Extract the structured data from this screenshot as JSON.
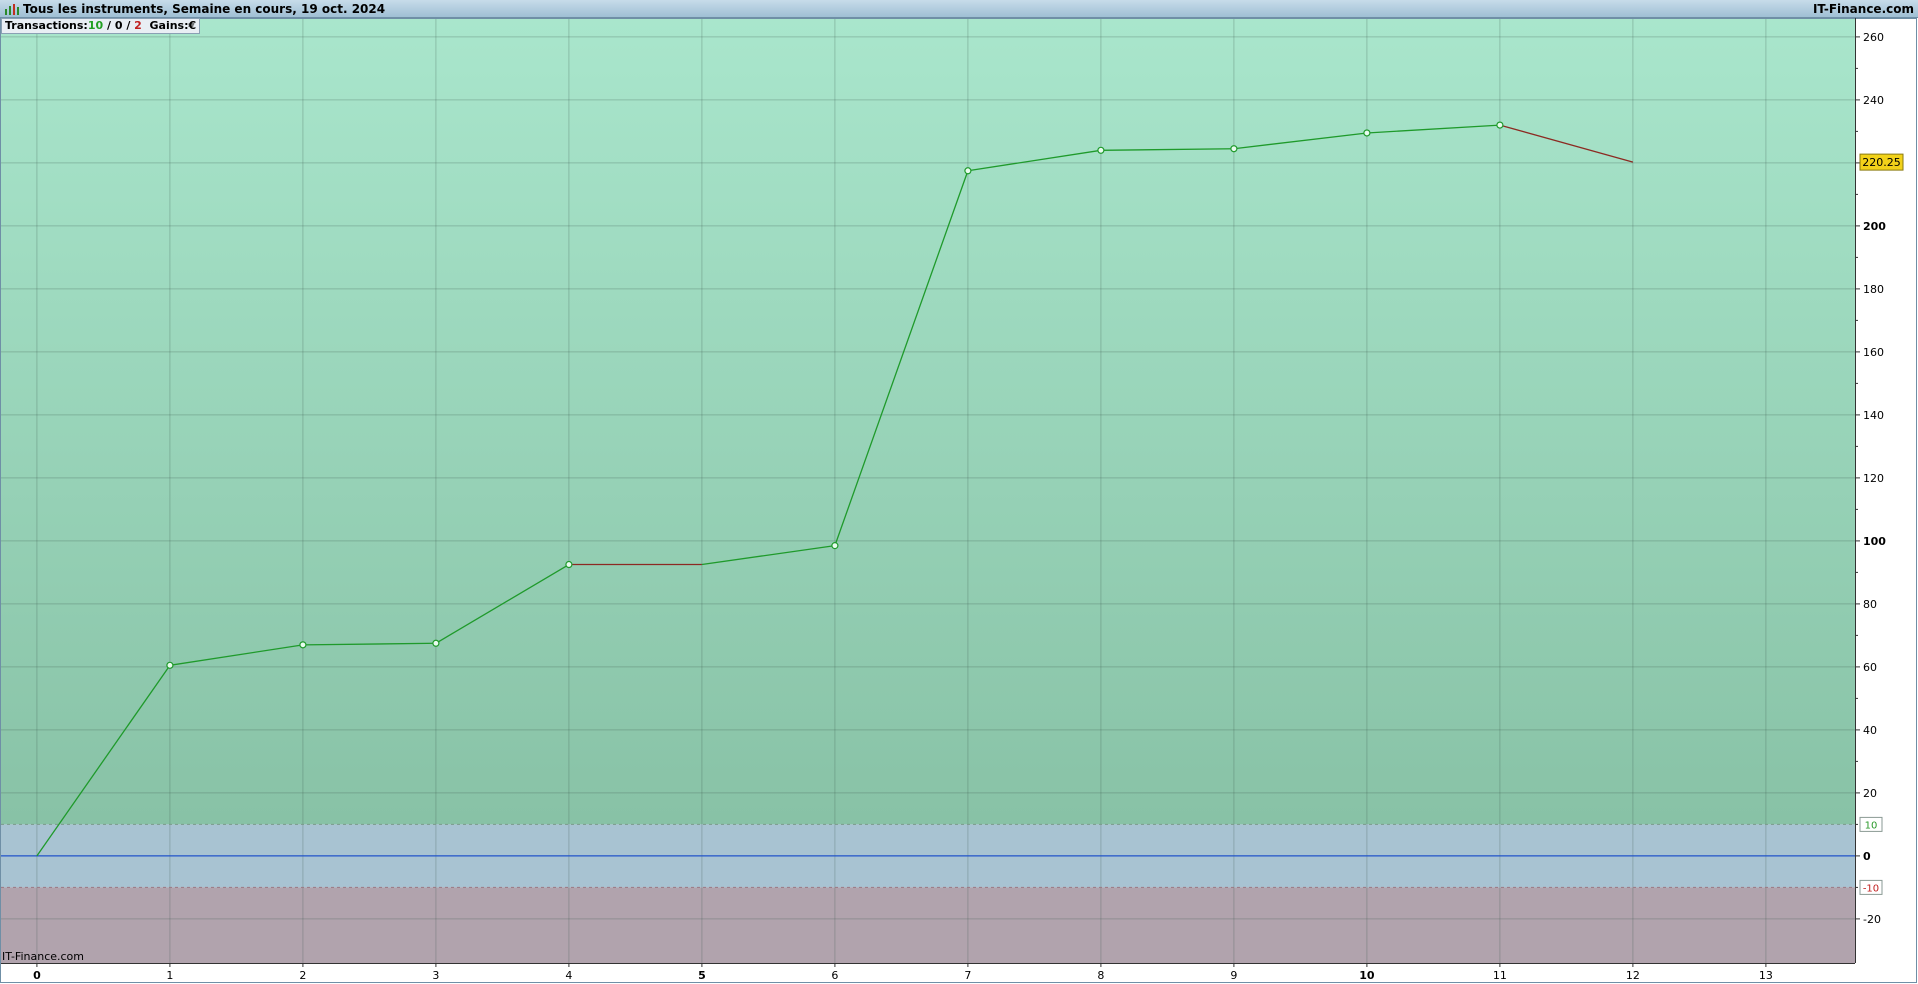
{
  "header": {
    "title": "Tous les instruments, Semaine en cours, 19 oct. 2024",
    "brand": "IT-Finance.com"
  },
  "info_box": {
    "label": "Transactions:",
    "wins": "10",
    "sep1": " / ",
    "neutral": "0",
    "sep2": " / ",
    "losses": "2",
    "gains_label": "Gains:",
    "currency": "€"
  },
  "footer": {
    "brand": "IT-Finance.com"
  },
  "colors": {
    "plot_top": "#a9e6cc",
    "plot_bottom": "#88c2a6",
    "neutral_band": "#a8c3d2",
    "negative_band": "#b1a3ad",
    "line_up": "#1f9a2b",
    "line_down": "#8c2a22",
    "zero_line": "#2255cc",
    "current_badge": "#f2d21a"
  },
  "chart_data": {
    "type": "line",
    "x": [
      0,
      1,
      2,
      3,
      4,
      5,
      6,
      7,
      8,
      9,
      10,
      11,
      12
    ],
    "values": [
      0,
      60.5,
      67,
      67.5,
      92.5,
      92.5,
      98.5,
      217.5,
      224,
      224.5,
      229.5,
      232,
      220.25
    ],
    "segment_direction": [
      "up",
      "up",
      "up",
      "up",
      "down",
      "up",
      "up",
      "up",
      "up",
      "up",
      "up",
      "down"
    ],
    "markers": [
      1,
      2,
      3,
      4,
      6,
      7,
      8,
      9,
      10,
      11
    ],
    "current_value_label": "220.25",
    "xlim": [
      -0.27,
      13.67
    ],
    "ylim": [
      -34,
      266
    ],
    "x_ticks": [
      0,
      1,
      2,
      3,
      4,
      5,
      6,
      7,
      8,
      9,
      10,
      11,
      12,
      13
    ],
    "x_tick_labels": [
      "0",
      "1",
      "2",
      "3",
      "4",
      "5",
      "6",
      "7",
      "8",
      "9",
      "10",
      "11",
      "12",
      "13"
    ],
    "x_major_ticks": [
      0,
      5,
      10
    ],
    "y_ticks": [
      -20,
      0,
      20,
      40,
      60,
      80,
      100,
      120,
      140,
      160,
      180,
      200,
      220,
      240,
      260
    ],
    "y_tick_labels": [
      "-20",
      "0",
      "20",
      "40",
      "60",
      "80",
      "100",
      "120",
      "140",
      "160",
      "180",
      "200",
      "",
      "240",
      "260"
    ],
    "y_major_ticks": [
      0,
      100,
      200
    ],
    "band_labels": {
      "upper": "10",
      "lower": "-10"
    },
    "bands": {
      "upper": 10,
      "lower": -10
    },
    "grid": true
  }
}
